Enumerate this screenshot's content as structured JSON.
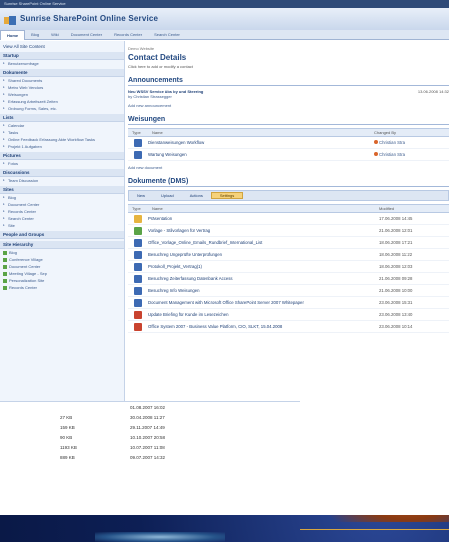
{
  "window_title": "Sunrise SharePoint Online Service",
  "site_title": "Sunrise SharePoint Online Service",
  "topnav": [
    "Home",
    "Blog",
    "Wiki",
    "Document Center",
    "Records Center",
    "Search Center"
  ],
  "sidebar": {
    "view_all": "View All Site Content",
    "sections": [
      {
        "title": "Startup",
        "items": [
          "Benutzerumfrage"
        ]
      },
      {
        "title": "Dokumente",
        "items": [
          "Shared Documents",
          "Metro Web Vendors",
          "Weisungen",
          "Erfassung Arbeitszeit Zeiten",
          "Ordnung Forms, Sales, etc."
        ]
      },
      {
        "title": "Lists",
        "items": [
          "Calendar",
          "Tasks",
          "Online Feedback Erfassung Akte Workflow Tasks",
          "Projekt 1 Aufgaben"
        ]
      },
      {
        "title": "Pictures",
        "items": [
          "Fotos"
        ]
      },
      {
        "title": "Discussions",
        "items": [
          "Team Discussion"
        ]
      },
      {
        "title": "Sites",
        "items": [
          "Blog",
          "Document Center",
          "Records Center",
          "Search Center",
          "Site"
        ]
      }
    ],
    "people_title": "People and Groups",
    "site_hierarchy": "Site Hierarchy",
    "people": [
      "Blog",
      "Conference Village",
      "Document Center",
      "Meeting Village - Sep",
      "Personalization Site",
      "Records Center"
    ]
  },
  "main": {
    "breadcrumb": "Demo Website",
    "contact_title": "Contact Details",
    "contact_sub": "Click here to add or modify a contact",
    "announcements_title": "Announcements",
    "announcement": {
      "title": "Neu WSSV Service übs by und Steering",
      "by": "by Christian Strassegger",
      "date": "13.06.2008 14:32"
    },
    "add_announcement": "Add new announcement",
    "weisungen_title": "Weisungen",
    "weisungen_header": [
      "Type",
      "Name",
      "Changed By"
    ],
    "weisungen_rows": [
      {
        "name": "Dienstanweisungen Workflow",
        "by": "Christian Stra"
      },
      {
        "name": "Wartung Weisungen",
        "by": "Christian Stra"
      }
    ],
    "add_document": "Add new document",
    "docs_title": "Dokumente (DMS)",
    "toolbar": [
      "New",
      "Upload",
      "Actions",
      "Settings"
    ],
    "docs_header": [
      "Type",
      "Name",
      "Modified"
    ],
    "docs_rows": [
      {
        "name": "Präsentation",
        "mod": "17.06.2008 14:45",
        "color": "#e6b440"
      },
      {
        "name": "Vorlage - Stilvorlagen für Vertrag",
        "mod": "21.06.2008 12:01",
        "color": "#5aa347"
      },
      {
        "name": "Office_Vorlage_Online_Emails_Rundbrief_International_List",
        "mod": "18.06.2008 17:21",
        "color": "#3d6ab3"
      },
      {
        "name": "Besuchreg Ungeprüfte Unterprüfungen",
        "mod": "18.06.2008 11:22",
        "color": "#3d6ab3"
      },
      {
        "name": "Protokoll_Projekt_Vertrag(1)",
        "mod": "18.06.2008 12:03",
        "color": "#3d6ab3"
      },
      {
        "name": "Besuchreg Zeiterfassung Datenbank Access",
        "mod": "21.06.2008 09:28",
        "color": "#3d6ab3"
      },
      {
        "name": "Besuchreg Info Weisungen",
        "mod": "21.06.2008 10:00",
        "color": "#3d6ab3"
      },
      {
        "name": "Document Management with Microsoft Office SharePoint Server 2007 Whitepaper",
        "mod": "23.06.2008 15:31",
        "color": "#3d6ab3"
      },
      {
        "name": "Update Briefing für Kunde im Lesezeichen",
        "mod": "23.06.2008 13:40",
        "color": "#c9432f"
      },
      {
        "name": "Office System 2007 - Business Value Platform, CIO, SLKT, 15.04.2008",
        "mod": "23.06.2008 10:14",
        "color": "#c9432f"
      }
    ]
  },
  "bottom_rows": [
    {
      "size": "",
      "date": "01.08.2007 16:02"
    },
    {
      "size": "27 KB",
      "date": "30.04.2008 11:27"
    },
    {
      "size": "159 KB",
      "date": "29.11.2007 14:49"
    },
    {
      "size": "90 KB",
      "date": "10.10.2007 20:58"
    },
    {
      "size": "1193 KB",
      "date": "10.07.2007 11:08"
    },
    {
      "size": "889 KB",
      "date": "09.07.2007 14:32"
    }
  ]
}
